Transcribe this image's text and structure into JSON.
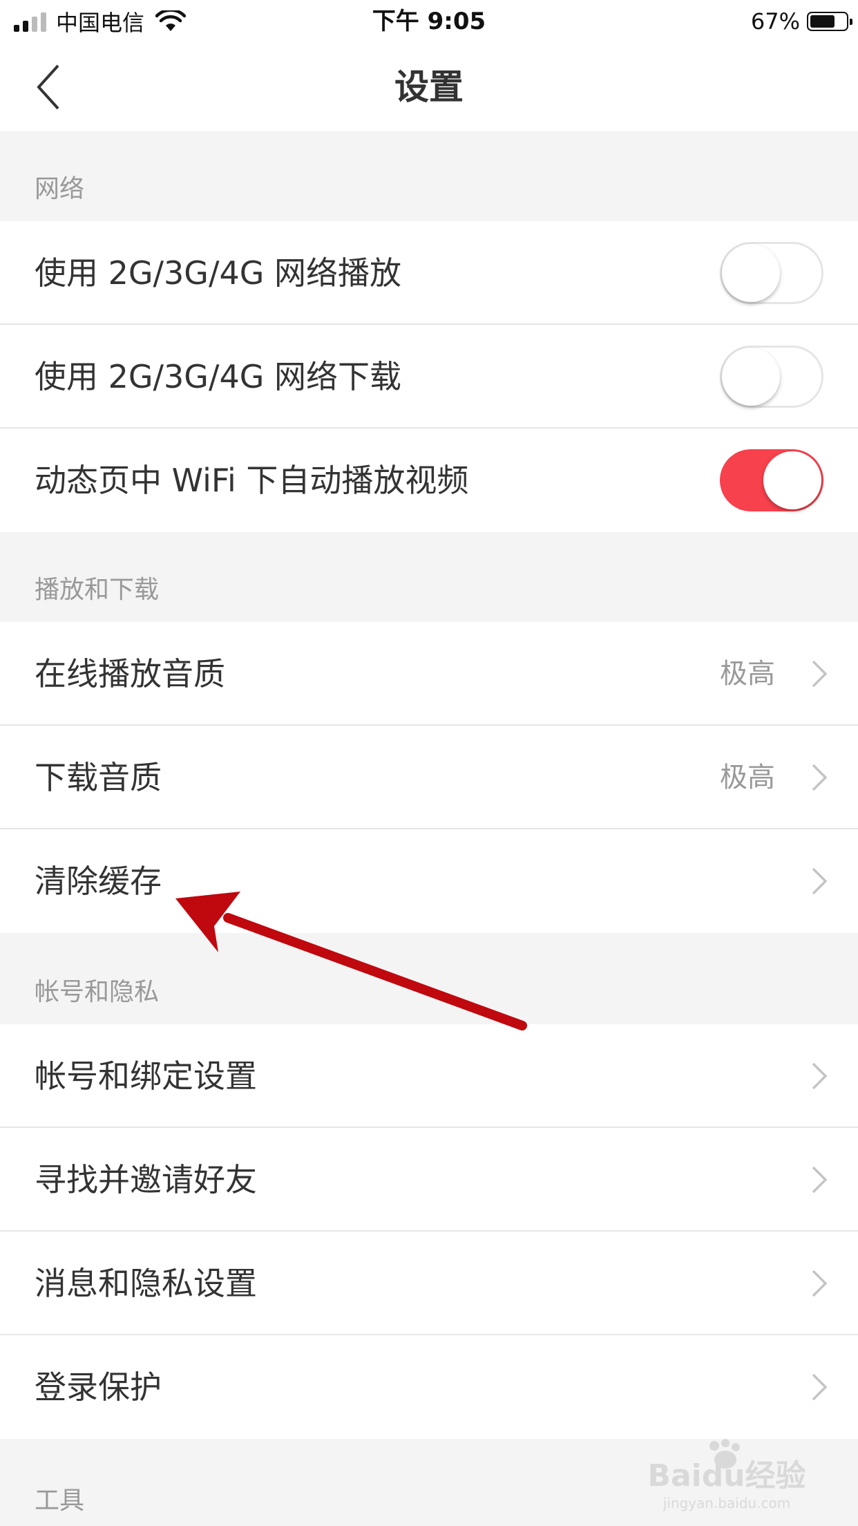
{
  "status_bar": {
    "carrier": "中国电信",
    "time": "下午 9:05",
    "battery": "67%",
    "battery_level": 0.67
  },
  "nav": {
    "title": "设置",
    "back_icon": "chevron-left-icon"
  },
  "sections": {
    "network": {
      "header": "网络",
      "items": [
        {
          "label": "使用 2G/3G/4G 网络播放",
          "toggle": false
        },
        {
          "label": "使用 2G/3G/4G 网络下载",
          "toggle": false
        },
        {
          "label": "动态页中 WiFi 下自动播放视频",
          "toggle": true
        }
      ]
    },
    "playback": {
      "header": "播放和下载",
      "items": [
        {
          "label": "在线播放音质",
          "value": "极高"
        },
        {
          "label": "下载音质",
          "value": "极高"
        },
        {
          "label": "清除缓存",
          "value": ""
        }
      ]
    },
    "account": {
      "header": "帐号和隐私",
      "items": [
        {
          "label": "帐号和绑定设置"
        },
        {
          "label": "寻找并邀请好友"
        },
        {
          "label": "消息和隐私设置"
        },
        {
          "label": "登录保护"
        }
      ]
    },
    "tools": {
      "header": "工具"
    }
  },
  "colors": {
    "toggle_on": "#f7414d",
    "annotation_arrow": "#c0080f"
  },
  "watermark": {
    "text": "Baidu经验",
    "url_text": "jingyan.baidu.com"
  }
}
